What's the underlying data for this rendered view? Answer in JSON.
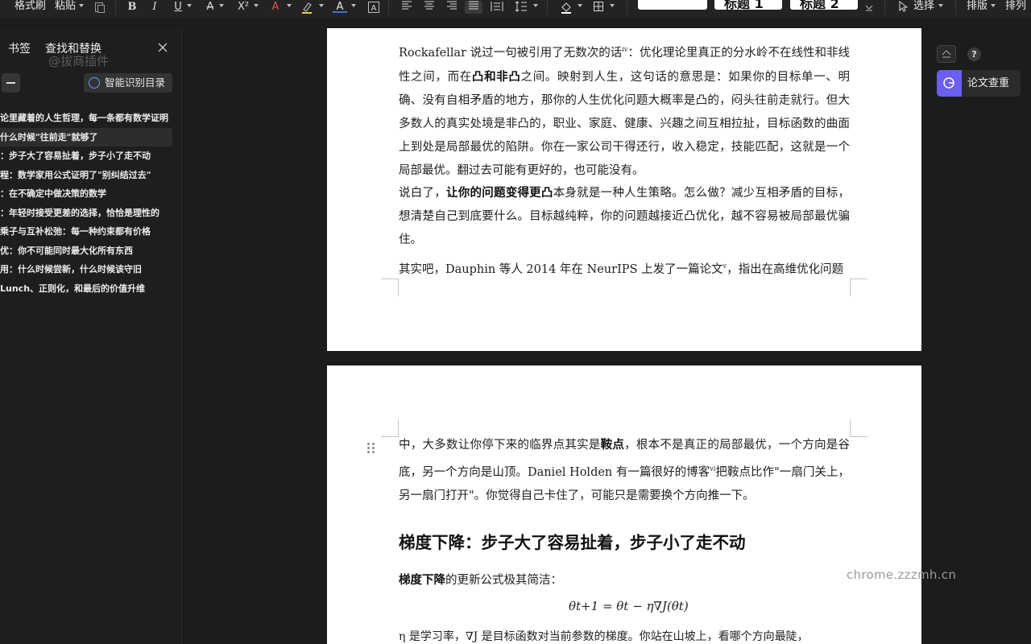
{
  "toolbar": {
    "format_painter": "格式刷",
    "paste": "粘贴",
    "style_heading1": "标题 1",
    "style_heading2": "标题 2",
    "select": "选择",
    "typeset": "排版",
    "arrange": "排列"
  },
  "left_panel": {
    "tab_bookmarks": "书签",
    "tab_find_replace": "查找和替换",
    "watermark": "@拔商插件",
    "ai_toc_button": "智能识别目录",
    "toc_items": [
      "论里藏着的人生哲理，每一条都有数学证明",
      "什么时候\"往前走\"就够了",
      "：步子大了容易扯着，步子小了走不动",
      "程：数学家用公式证明了\"别纠结过去\"",
      "：在不确定中做决策的数学",
      "：年轻时接受更差的选择，恰恰是理性的",
      "乘子与互补松弛：每一种约束都有价格",
      "优：你不可能同时最大化所有东西",
      "用：什么时候尝新，什么时候该守旧",
      "Lunch、正则化，和最后的价值升维"
    ],
    "active_index": 1
  },
  "page1": {
    "p1_a": "Rockafellar 说过一句被引用了无数次的话",
    "p1_sup": "ⅳ",
    "p1_b": "：优化理论里真正的分水岭不在线性和非线性之间，而在",
    "p1_bold": "凸和非凸",
    "p1_c": "之间。映射到人生，这句话的意思是：如果你的目标单一、明确、没有自相矛盾的地方，那你的人生优化问题大概率是凸的，闷头往前走就行。但大多数人的真实处境是非凸的，职业、家庭、健康、兴趣之间互相拉扯，目标函数的曲面上到处是局部最优的陷阱。你在一家公司干得还行，收入稳定，技能匹配，这就是一个局部最优。翻过去可能有更好的，也可能没有。",
    "p2_a": "说白了，",
    "p2_bold": "让你的问题变得更凸",
    "p2_b": "本身就是一种人生策略。怎么做？减少互相矛盾的目标，想清楚自己到底要什么。目标越纯粹，你的问题越接近凸优化，越不容易被局部最优骗住。",
    "p3_a": "其实吧，Dauphin 等人 2014 年在 NeurIPS 上发了一篇论文",
    "p3_sup": "ⅴ",
    "p3_b": "，指出在高维优化问题"
  },
  "page2": {
    "p1_a": "中，大多数让你停下来的临界点其实是",
    "p1_bold": "鞍点",
    "p1_b": "，根本不是真正的局部最优，一个方向是谷底，另一个方向是山顶。Daniel Holden 有一篇很好的博客",
    "p1_sup": "ⅵ",
    "p1_c": "把鞍点比作\"一扇门关上，另一扇门打开\"。你觉得自己卡住了，可能只是需要换个方向推一下。",
    "heading": "梯度下降：步子大了容易扯着，步子小了走不动",
    "p2_bold": "梯度下降",
    "p2_rest": "的更新公式极其简洁：",
    "formula": "θt+1 = θt − η∇J(θt)",
    "p3": "η 是学习率，∇J 是目标函数对当前参数的梯度。你站在山坡上，看哪个方向最陡，"
  },
  "right_panel": {
    "help": "?",
    "paper_check": "论文查重"
  },
  "site_watermark": "chrome.zzzmh.cn",
  "colors": {
    "background": "#1b1c1c",
    "page": "#ffffff",
    "accent_purple": "#6b5ff0"
  }
}
